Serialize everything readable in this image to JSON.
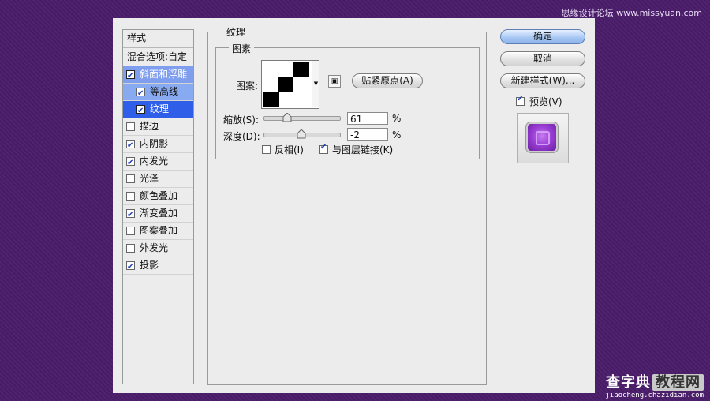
{
  "watermark_top": "思缘设计论坛 www.missyuan.com",
  "watermark_bottom": {
    "main": "查字典",
    "tag": "教程网",
    "url": "jiaocheng.chazidian.com"
  },
  "styles_panel": {
    "header": "样式",
    "blend_options": "混合选项:自定",
    "items": [
      {
        "label": "斜面和浮雕",
        "checked": true
      },
      {
        "label": "等高线",
        "checked": true
      },
      {
        "label": "纹理",
        "checked": true
      },
      {
        "label": "描边",
        "checked": false
      },
      {
        "label": "内阴影",
        "checked": true
      },
      {
        "label": "内发光",
        "checked": true
      },
      {
        "label": "光泽",
        "checked": false
      },
      {
        "label": "颜色叠加",
        "checked": false
      },
      {
        "label": "渐变叠加",
        "checked": true
      },
      {
        "label": "图案叠加",
        "checked": false
      },
      {
        "label": "外发光",
        "checked": false
      },
      {
        "label": "投影",
        "checked": true
      }
    ]
  },
  "texture": {
    "title": "纹理",
    "group_title": "图素",
    "pattern_label": "图案:",
    "snap_button": "贴紧原点(A)",
    "scale_label": "缩放(S):",
    "scale_value": "61",
    "scale_fraction": 0.3,
    "depth_label": "深度(D):",
    "depth_value": "-2",
    "depth_fraction": 0.49,
    "percent": "%",
    "invert_label": "反相(I)",
    "invert_checked": false,
    "link_label": "与图层链接(K)",
    "link_checked": true
  },
  "buttons": {
    "ok": "确定",
    "cancel": "取消",
    "new_style": "新建样式(W)..."
  },
  "preview": {
    "label": "预览(V)",
    "checked": true
  },
  "colors": {
    "active_item": "#2f5fe8",
    "sub_item": "#88aaf0",
    "background": "#4a1c6a"
  }
}
